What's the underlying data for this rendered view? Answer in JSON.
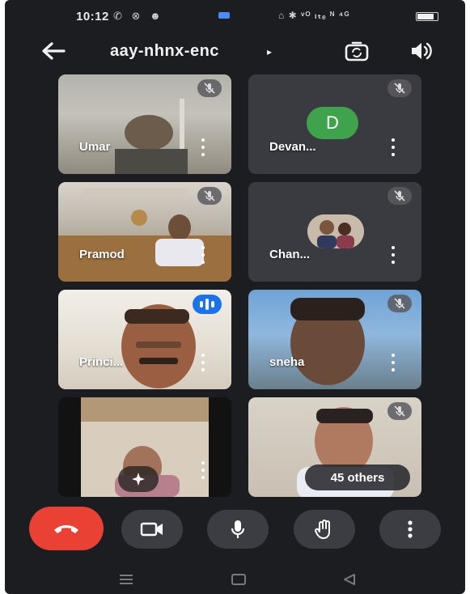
{
  "status_bar": {
    "time": "10:12",
    "left_icons": "✆ ⊗ ☻",
    "right_icons": "⌂ ✱ ᵛᴼ ₗₜₑ ᴺ ⁴ᴳ"
  },
  "header": {
    "meeting_code": "aay-nhnx-enc",
    "caret": "▸",
    "icons": {
      "back": "arrow-left-icon",
      "switch_camera": "switch-camera-icon",
      "audio": "speaker-icon"
    }
  },
  "tiles": [
    {
      "name": "Umar",
      "muted": true
    },
    {
      "name": "Devan...",
      "muted": true,
      "avatar_letter": "D",
      "avatar_color": "#3fa34d"
    },
    {
      "name": "Pramod",
      "muted": true
    },
    {
      "name": "Chan...",
      "muted": true
    },
    {
      "name": "Princi...",
      "speaking": true
    },
    {
      "name": "sneha",
      "muted": true
    },
    {
      "name": ""
    },
    {
      "name": "",
      "muted": true,
      "others_label": "45 others"
    }
  ],
  "controls": {
    "end_call": "end-call-icon",
    "camera": "video-camera-icon",
    "mic": "microphone-icon",
    "raise_hand": "raise-hand-icon",
    "more": "more-vertical-icon",
    "colors": {
      "end_call": "#e94235",
      "button_bg": "#3c3d42",
      "speaking": "#1a73e8"
    }
  },
  "nav_bar": {
    "icons": [
      "menu-icon",
      "home-icon",
      "back-triangle-icon"
    ]
  }
}
